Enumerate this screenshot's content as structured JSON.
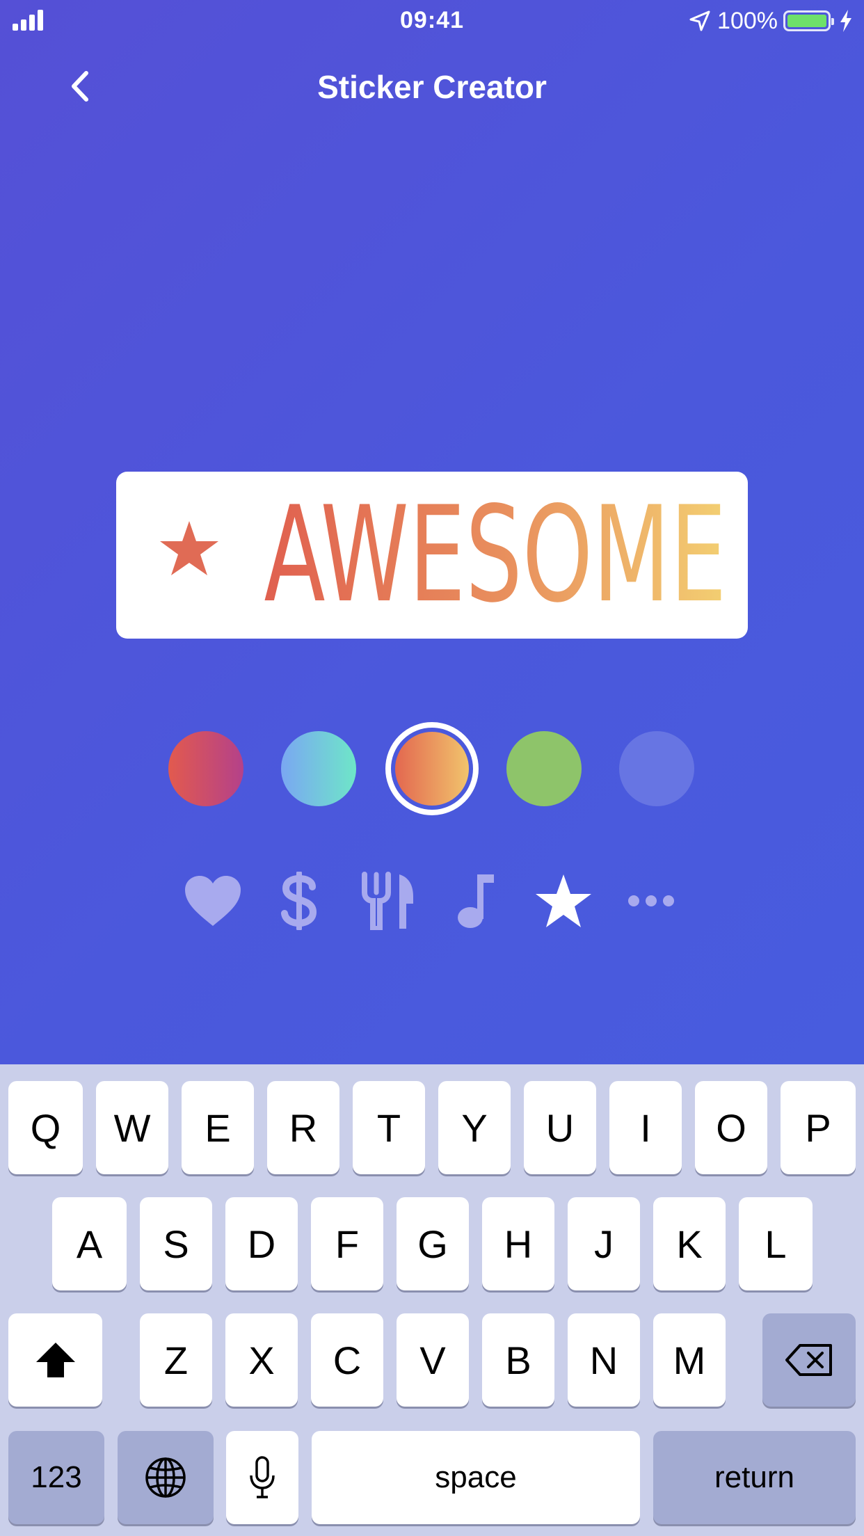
{
  "status_bar": {
    "time": "09:41",
    "battery_percent": "100%",
    "battery_level": 1.0,
    "icons": [
      "signal-icon",
      "location-icon",
      "battery-icon",
      "charging-icon"
    ]
  },
  "nav": {
    "title": "Sticker Creator",
    "back_icon": "chevron-left-icon"
  },
  "sticker": {
    "text": "AWESOME",
    "icon": "star-icon",
    "gradient": [
      "#E0604F",
      "#F3CF72"
    ]
  },
  "color_swatches": [
    {
      "name": "red-purple",
      "colors": [
        "#E25A4E",
        "#B4418A"
      ],
      "selected": false
    },
    {
      "name": "blue-teal",
      "colors": [
        "#7AA7F2",
        "#6EE6C8"
      ],
      "selected": false
    },
    {
      "name": "orange-yellow",
      "colors": [
        "#E2624E",
        "#F2C96E"
      ],
      "selected": true
    },
    {
      "name": "green",
      "colors": [
        "#8EC46A"
      ],
      "selected": false
    },
    {
      "name": "translucent",
      "colors": [
        "#8C96EB"
      ],
      "selected": false
    }
  ],
  "sticker_icons": [
    {
      "name": "heart-icon",
      "selected": false
    },
    {
      "name": "dollar-icon",
      "selected": false
    },
    {
      "name": "fork-knife-icon",
      "selected": false
    },
    {
      "name": "music-note-icon",
      "selected": false
    },
    {
      "name": "star-icon",
      "selected": true
    },
    {
      "name": "more-icon",
      "selected": false
    }
  ],
  "keyboard": {
    "row1": [
      "Q",
      "W",
      "E",
      "R",
      "T",
      "Y",
      "U",
      "I",
      "O",
      "P"
    ],
    "row2": [
      "A",
      "S",
      "D",
      "F",
      "G",
      "H",
      "J",
      "K",
      "L"
    ],
    "row3": [
      "Z",
      "X",
      "C",
      "V",
      "B",
      "N",
      "M"
    ],
    "numbers_label": "123",
    "space_label": "space",
    "return_label": "return",
    "icons": [
      "shift-icon",
      "backspace-icon",
      "globe-icon",
      "microphone-icon"
    ]
  },
  "colors": {
    "background": "#4B58DC",
    "keyboard_bg": "#CACFEA",
    "dark_key": "#A3ABD2"
  }
}
